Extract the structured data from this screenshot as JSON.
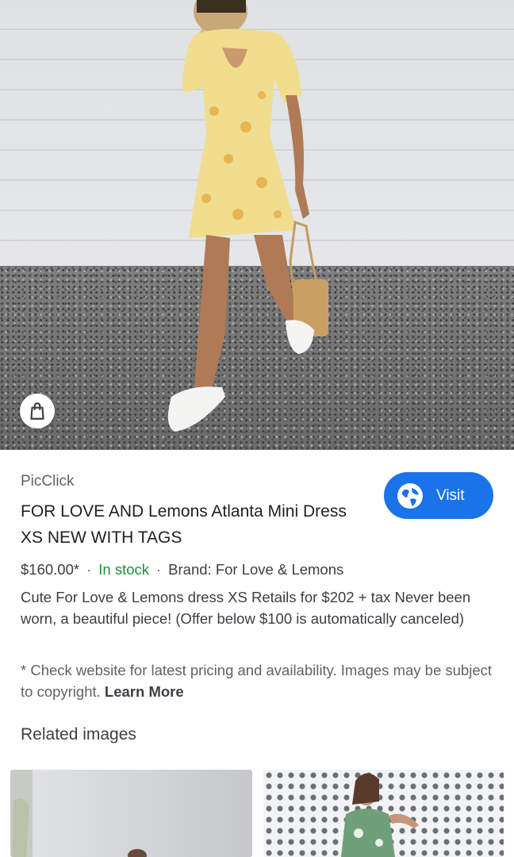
{
  "product": {
    "source": "PicClick",
    "title": "FOR LOVE AND Lemons Atlanta Mini Dress XS NEW WITH TAGS",
    "price": "$160.00*",
    "separator": "·",
    "stock_status": "In stock",
    "brand": "Brand: For Love & Lemons",
    "description": "Cute For Love & Lemons dress XS Retails for $202 + tax Never been worn, a beautiful piece! (Offer below $100 is automatically canceled)",
    "disclaimer": "* Check website for latest pricing and availability. Images may be subject to copyright.",
    "learn_more": "Learn More"
  },
  "visit_button": {
    "label": "Visit",
    "icon": "globe-icon",
    "color": "#1a73e8"
  },
  "shopping_chip": {
    "icon": "shopping-bag-icon"
  },
  "related": {
    "heading": "Related images"
  },
  "colors": {
    "in_stock": "#1e8e3e",
    "accent": "#1a73e8"
  }
}
